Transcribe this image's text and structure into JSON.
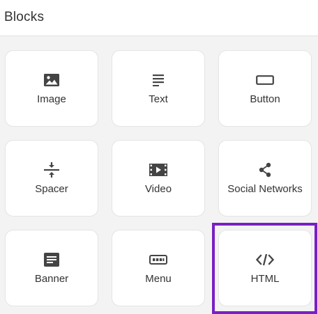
{
  "header": {
    "title": "Blocks"
  },
  "blocks": [
    {
      "label": "Image",
      "icon": "image-icon"
    },
    {
      "label": "Text",
      "icon": "text-icon"
    },
    {
      "label": "Button",
      "icon": "button-icon"
    },
    {
      "label": "Spacer",
      "icon": "spacer-icon"
    },
    {
      "label": "Video",
      "icon": "video-icon"
    },
    {
      "label": "Social Networks",
      "icon": "share-icon"
    },
    {
      "label": "Banner",
      "icon": "banner-icon"
    },
    {
      "label": "Menu",
      "icon": "menu-icon"
    },
    {
      "label": "HTML",
      "icon": "code-icon"
    }
  ],
  "colors": {
    "highlight": "#7a1fc4",
    "icon": "#444444",
    "text": "#333333"
  }
}
